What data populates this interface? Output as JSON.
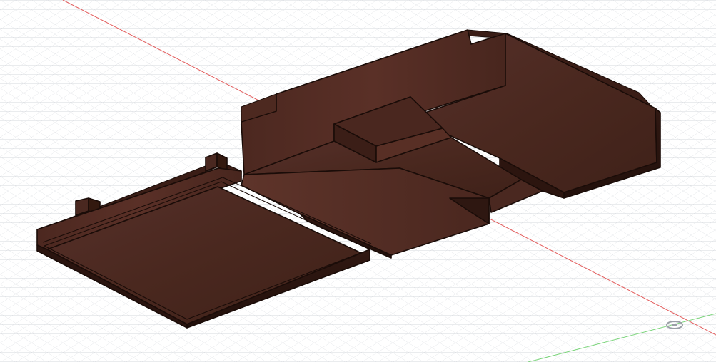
{
  "viewport": {
    "background": "#ffffff",
    "grid_color": "#d6d9de",
    "x_axis_color": "#e35c5c",
    "z_axis_color": "#7bd47b",
    "model_colors": {
      "top": "#4f2a20",
      "top_dark": "#3e2019",
      "left_face": "#2a140f",
      "right_face": "#5a2f24",
      "edge": "#1a0c08"
    }
  },
  "icons": {
    "origin_marker": "origin-marker-icon"
  }
}
